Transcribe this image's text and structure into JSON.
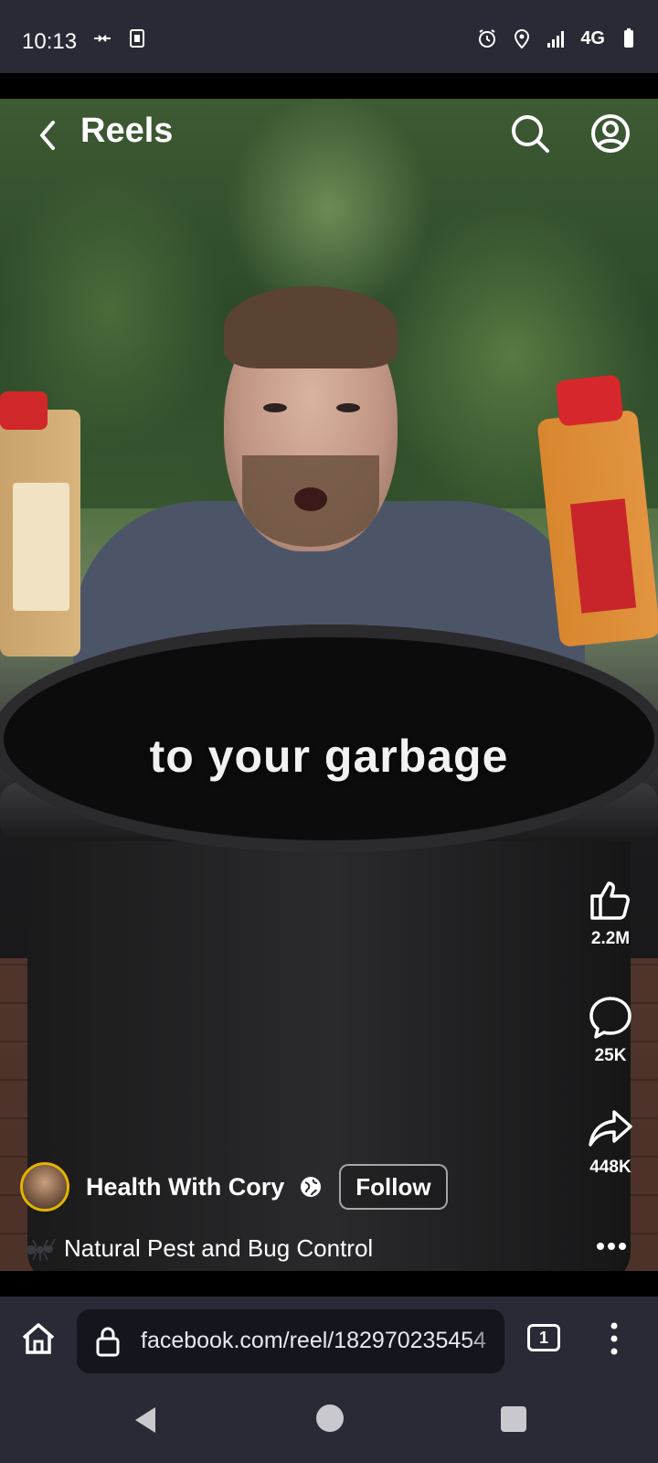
{
  "status_bar": {
    "time": "10:13",
    "network": "4G",
    "icons": [
      "data-transfer-icon",
      "sim-card-icon",
      "alarm-icon",
      "location-icon",
      "signal-icon",
      "battery-icon"
    ]
  },
  "header": {
    "title": "Reels",
    "icons": [
      "back-arrow-icon",
      "search-icon",
      "profile-icon"
    ]
  },
  "video": {
    "caption": "to your garbage"
  },
  "actions": {
    "likes": "2.2M",
    "comments": "25K",
    "shares": "448K",
    "icons": [
      "like-icon",
      "comment-icon",
      "share-icon"
    ]
  },
  "owner": {
    "name": "Health With Cory",
    "follow_label": "Follow",
    "icons": [
      "avatar",
      "globe-icon"
    ]
  },
  "audio": {
    "title": "Natural Pest and Bug Control",
    "icon": "ant-icon"
  },
  "browser": {
    "url": "facebook.com/reel/182970235454",
    "tab_count": "1",
    "icons": [
      "home-icon",
      "lock-icon",
      "tabs-icon",
      "menu-icon"
    ]
  },
  "nav": {
    "icons": [
      "nav-back-icon",
      "nav-home-icon",
      "nav-recents-icon"
    ]
  }
}
